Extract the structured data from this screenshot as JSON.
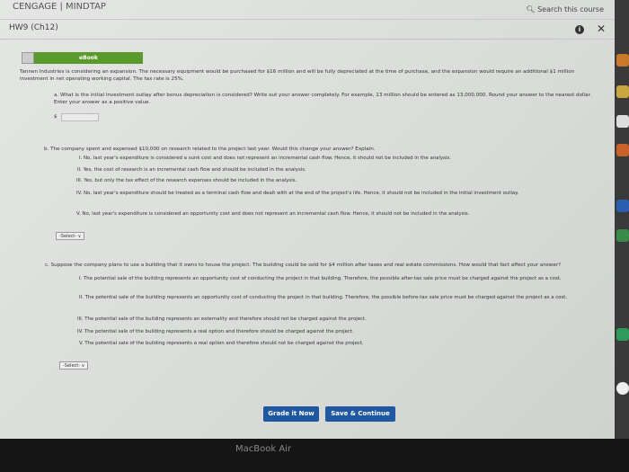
{
  "header": {
    "brand": "CENGAGE | MINDTAP",
    "search": "Search this course",
    "assignment": "HW9 (Ch12)",
    "info": "i",
    "close": "✕"
  },
  "ebook": "eBook",
  "intro": "Tannen Industries is considering an expansion. The necessary equipment would be purchased for $16 million and will be fully depreciated at the time of purchase, and the expansion would require an additional $1 million investment in net operating working capital. The tax rate is 25%.",
  "qa": {
    "text": "a. What is the initial investment outlay after bonus depreciation is considered? Write out your answer completely. For example, 13 million should be entered as 13,000,000. Round your answer to the nearest dollar. Enter your answer as a positive value.",
    "currency": "$",
    "value": ""
  },
  "qb": {
    "text": "b. The company spent and expensed $10,000 on research related to the project last year. Would this change your answer? Explain.",
    "options": [
      "I. No, last year's expenditure is considered a sunk cost and does not represent an incremental cash flow. Hence, it should not be included in the analysis.",
      "II. Yes, the cost of research is an incremental cash flow and should be included in the analysis.",
      "III. Yes, but only the tax effect of the research expenses should be included in the analysis.",
      "IV. No, last year's expenditure should be treated as a terminal cash flow and dealt with at the end of the project's life. Hence, it should not be included in the initial investment outlay.",
      "V. No, last year's expenditure is considered an opportunity cost and does not represent an incremental cash flow. Hence, it should not be included in the analysis."
    ],
    "select": "-Select- ∨"
  },
  "qc": {
    "text": "c. Suppose the company plans to use a building that it owns to house the project. The building could be sold for $4 million after taxes and real estate commissions. How would that fact affect your answer?",
    "options": [
      "I. The potential sale of the building represents an opportunity cost of conducting the project in that building. Therefore, the possible after-tax sale price must be charged against the project as a cost.",
      "II. The potential sale of the building represents an opportunity cost of conducting the project in that building. Therefore, the possible before-tax sale price must be charged against the project as a cost.",
      "III. The potential sale of the building represents an externality and therefore should not be charged against the project.",
      "IV. The potential sale of the building represents a real option and therefore should be charged against the project.",
      "V. The potential sale of the building represents a real option and therefore should not be charged against the project."
    ],
    "select": "-Select- ∨"
  },
  "buttons": {
    "grade": "Grade it Now",
    "save": "Save & Continue"
  },
  "laptop": "MacBook Air",
  "colors": {
    "ebook": "#5a9a2a",
    "button": "#1f57a0"
  }
}
